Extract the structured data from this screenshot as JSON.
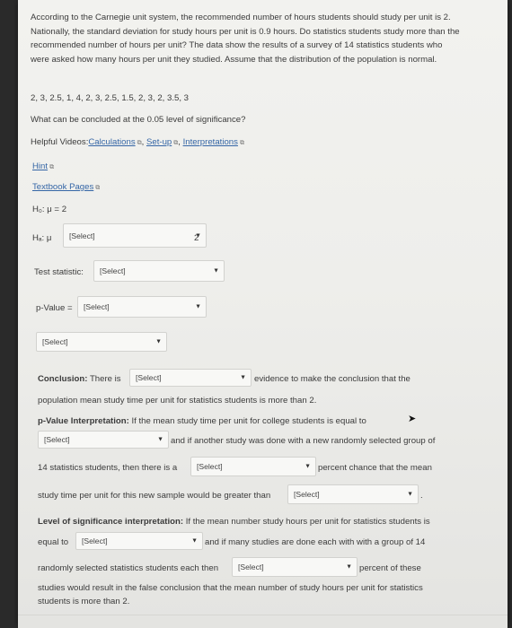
{
  "question": {
    "paragraph": "According to the Carnegie unit system, the recommended number of hours students should study per unit is 2. Nationally, the standard deviation for study hours per unit is 0.9 hours. Do statistics students study more than the recommended number of hours per unit? The data show the results of a survey of 14 statistics students who were asked how many hours per unit they studied. Assume that the distribution of the population is normal.",
    "data_line": "2, 3, 2.5, 1, 4, 2, 3, 2.5, 1.5, 2, 3, 2, 3.5, 3",
    "prompt": "What can be concluded at the 0.05 level of significance?"
  },
  "helpful_videos": {
    "label": "Helpful Videos:",
    "calculations": "Calculations",
    "setup": "Set-up",
    "interpretations": "Interpretations"
  },
  "hint": "Hint",
  "textbook_pages": "Textbook Pages",
  "h0": "H₀: μ = 2",
  "ha": {
    "prefix": "Hₐ: μ",
    "select": "[Select]",
    "value": "2"
  },
  "test_statistic": {
    "label": "Test statistic:",
    "select": "[Select]"
  },
  "p_value": {
    "label": "p-Value =",
    "select": "[Select]"
  },
  "decision_select": "[Select]",
  "conclusion": {
    "label": "Conclusion:",
    "pre": "There is",
    "select": "[Select]",
    "post": "evidence to make the conclusion that the",
    "line2": "population mean study time per unit for statistics students is more than 2."
  },
  "pvalue_interp": {
    "label": "p-Value Interpretation:",
    "text1": "If the mean study time per unit for college students is equal to",
    "select1": "[Select]",
    "text2": "and if another study was done with a new randomly selected group of",
    "text3": "14 statistics students, then there is a",
    "select2": "[Select]",
    "text4": "percent chance that the mean",
    "text5": "study time per unit for this new sample would be greater than",
    "select3": "[Select]",
    "text6": "."
  },
  "los_interp": {
    "label": "Level of significance interpretation:",
    "text1": "If the mean number study hours per unit for statistics students is",
    "text2": "equal to",
    "select1": "[Select]",
    "text3": "and if many studies are done each with with a group of 14",
    "text4": "randomly selected statistics students each then",
    "select2": "[Select]",
    "text5": "percent of these",
    "text6": "studies would result in the false conclusion that the mean number of study hours per unit for statistics",
    "text7": "students is more than 2."
  },
  "colors": {
    "link": "#3566a6",
    "page": "#f0f0ed",
    "background": "#2a2a2a"
  }
}
